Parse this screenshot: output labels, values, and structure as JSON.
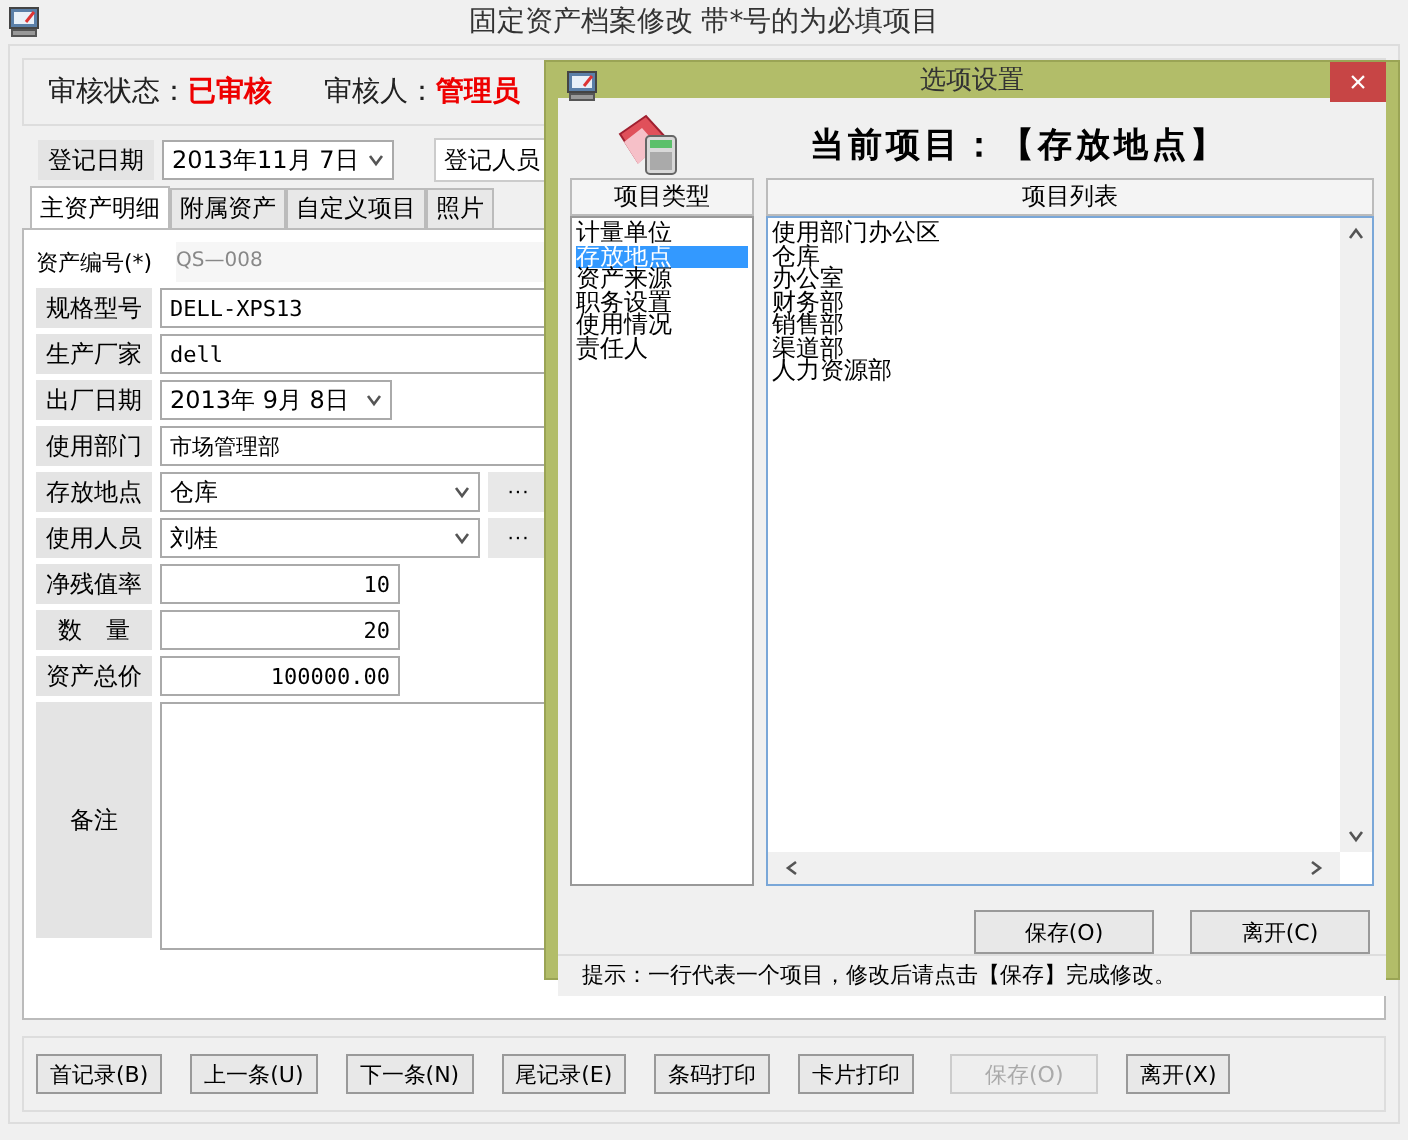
{
  "window": {
    "title": "固定资产档案修改 带*号的为必填项目"
  },
  "audit": {
    "status_label": "审核状态：",
    "status_value": "已审核",
    "auditor_label": "审核人：",
    "auditor_value": "管理员"
  },
  "registration": {
    "date_label": "登记日期",
    "date_value": "2013年11月 7日",
    "registrant_label": "登记人员"
  },
  "tabs": [
    {
      "label": "主资产明细",
      "selected": true
    },
    {
      "label": "附属资产",
      "selected": false
    },
    {
      "label": "自定义项目",
      "selected": false
    },
    {
      "label": "照片",
      "selected": false
    }
  ],
  "fields": [
    {
      "kind": "code",
      "label": "资产编号(*)",
      "value": "QS—008"
    },
    {
      "kind": "text",
      "label": "规格型号",
      "value": "DELL-XPS13"
    },
    {
      "kind": "text",
      "label": "生产厂家",
      "value": "dell"
    },
    {
      "kind": "date",
      "label": "出厂日期",
      "value": "2013年 9月 8日"
    },
    {
      "kind": "text",
      "label": "使用部门",
      "value": "市场管理部"
    },
    {
      "kind": "combo",
      "label": "存放地点",
      "value": "仓库",
      "more": "···"
    },
    {
      "kind": "combo",
      "label": "使用人员",
      "value": "刘桂",
      "more": "···"
    },
    {
      "kind": "number",
      "label": "净残值率",
      "value": "10"
    },
    {
      "kind": "number",
      "label": "数　量",
      "value": "20"
    },
    {
      "kind": "number",
      "label": "资产总价",
      "value": "100000.00"
    },
    {
      "kind": "note",
      "label": "备注"
    }
  ],
  "buttons": [
    {
      "label": "首记录(B)",
      "disabled": false
    },
    {
      "label": "上一条(U)",
      "disabled": false
    },
    {
      "label": "下一条(N)",
      "disabled": false
    },
    {
      "label": "尾记录(E)",
      "disabled": false
    },
    {
      "label": "条码打印",
      "disabled": false
    },
    {
      "label": "卡片打印",
      "disabled": false
    },
    {
      "label": "保存(O)",
      "disabled": true
    },
    {
      "label": "离开(X)",
      "disabled": false
    }
  ],
  "dialog": {
    "title": "选项设置",
    "close": "×",
    "current_item": "当前项目：【存放地点】",
    "type_header": "项目类型",
    "types": [
      {
        "label": "计量单位",
        "selected": false
      },
      {
        "label": "存放地点",
        "selected": true
      },
      {
        "label": "资产来源",
        "selected": false
      },
      {
        "label": "职务设置",
        "selected": false
      },
      {
        "label": "使用情况",
        "selected": false
      },
      {
        "label": "责任人",
        "selected": false
      }
    ],
    "list_header": "项目列表",
    "list_items": [
      "使用部门办公区",
      "仓库",
      "办公室",
      "财务部",
      "销售部",
      "渠道部",
      "人力资源部"
    ],
    "buttons": [
      "保存(O)",
      "离开(C)"
    ],
    "hint": "提示：一行代表一个项目，修改后请点击【保存】完成修改。"
  }
}
